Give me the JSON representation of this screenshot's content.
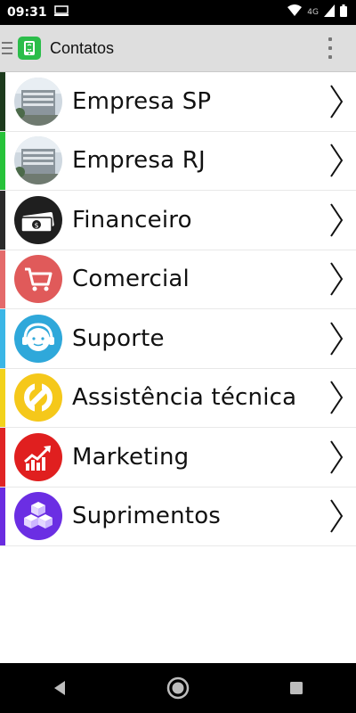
{
  "status_bar": {
    "time": "09:31",
    "network": "4G"
  },
  "app_bar": {
    "title": "Contatos",
    "logo_icon": "phone-app-icon"
  },
  "contacts": [
    {
      "label": "Empresa SP",
      "stripe_color": "#1d3b1d",
      "icon": "building-photo-icon"
    },
    {
      "label": "Empresa RJ",
      "stripe_color": "#27c23a",
      "icon": "building-photo-icon"
    },
    {
      "label": "Financeiro",
      "stripe_color": "#2a2a2a",
      "icon": "money-icon"
    },
    {
      "label": "Comercial",
      "stripe_color": "#e46a6a",
      "icon": "cart-icon"
    },
    {
      "label": "Suporte",
      "stripe_color": "#3bb6e6",
      "icon": "support-agent-icon"
    },
    {
      "label": "Assistência técnica",
      "stripe_color": "#f2d21c",
      "icon": "wrench-icon"
    },
    {
      "label": "Marketing",
      "stripe_color": "#e02424",
      "icon": "growth-chart-icon"
    },
    {
      "label": "Suprimentos",
      "stripe_color": "#6a2ce0",
      "icon": "boxes-icon"
    }
  ],
  "nav_bar": {
    "icons": [
      "back-icon",
      "home-icon",
      "recents-icon"
    ]
  }
}
